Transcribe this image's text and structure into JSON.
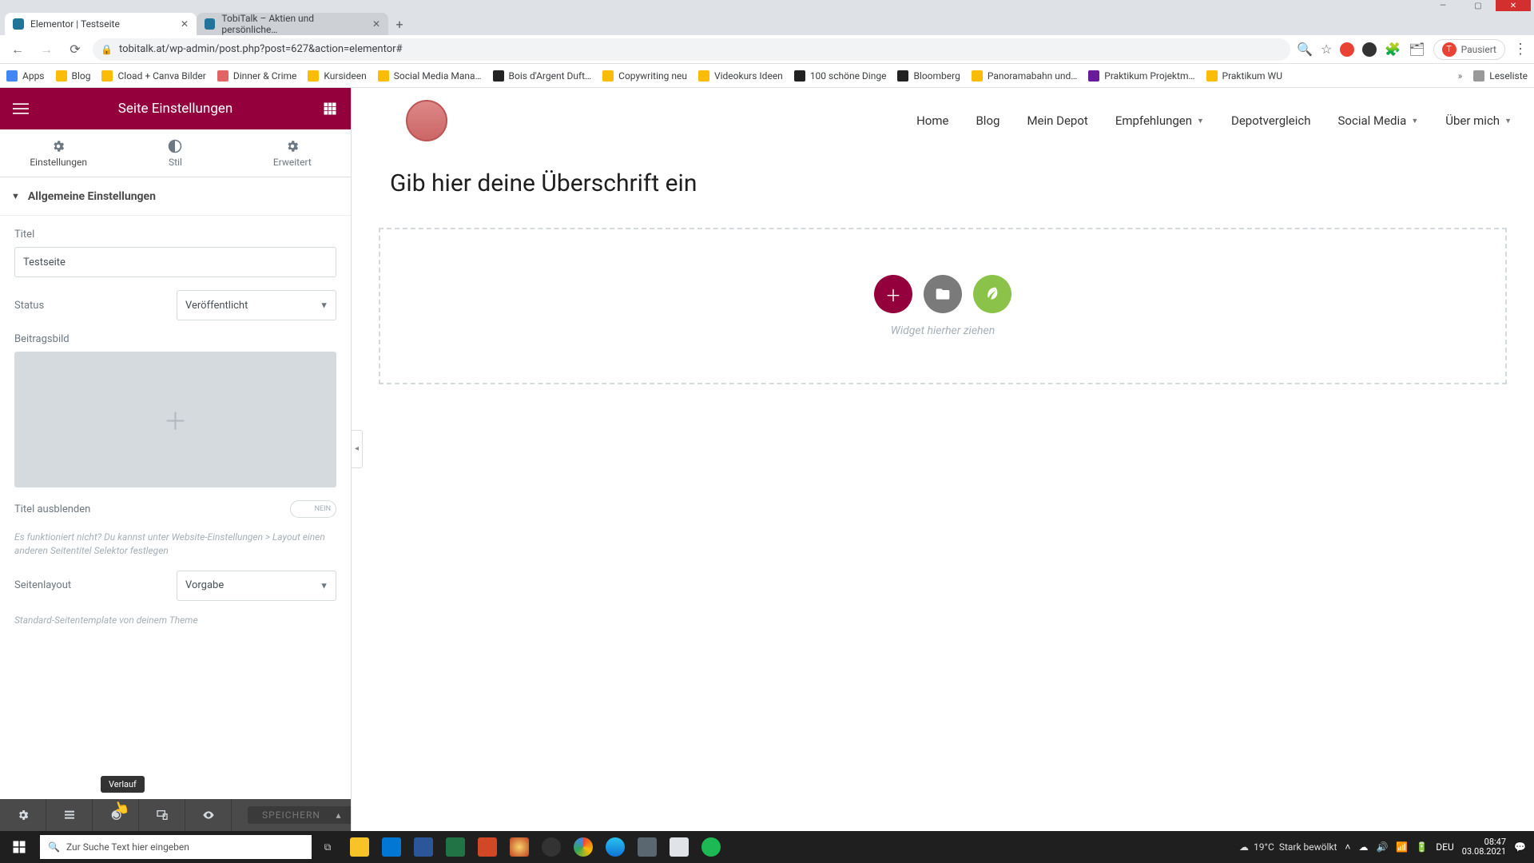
{
  "browser": {
    "tabs": [
      {
        "title": "Elementor | Testseite",
        "active": true
      },
      {
        "title": "TobiTalk – Aktien und persönliche…",
        "active": false
      }
    ],
    "url": "tobitalk.at/wp-admin/post.php?post=627&action=elementor#",
    "profile_label": "Pausiert",
    "profile_initial": "T",
    "bookmarks": [
      "Apps",
      "Blog",
      "Cload + Canva Bilder",
      "Dinner & Crime",
      "Kursideen",
      "Social Media Mana…",
      "Bois d'Argent Duft…",
      "Copywriting neu",
      "Videokurs Ideen",
      "100 schöne Dinge",
      "Bloomberg",
      "Panoramabahn und…",
      "Praktikum Projektm…",
      "Praktikum WU"
    ],
    "readlist_label": "Leseliste"
  },
  "sidebar": {
    "title": "Seite Einstellungen",
    "tabs": {
      "settings": "Einstellungen",
      "style": "Stil",
      "advanced": "Erweitert"
    },
    "accordion": "Allgemeine Einstellungen",
    "labels": {
      "title": "Titel",
      "status": "Status",
      "featured": "Beitragsbild",
      "hide_title": "Titel ausblenden",
      "hint1": "Es funktioniert nicht? Du kannst unter Website-Einstellungen > Layout einen anderen Seitentitel Selektor festlegen",
      "layout": "Seitenlayout",
      "hint2": "Standard-Seitentemplate von deinem Theme"
    },
    "values": {
      "title": "Testseite",
      "status": "Veröffentlicht",
      "layout": "Vorgabe",
      "hide_title_toggle": "NEIN"
    },
    "footer": {
      "tooltip": "Verlauf",
      "save": "SPEICHERN"
    }
  },
  "canvas": {
    "nav": [
      "Home",
      "Blog",
      "Mein Depot",
      "Empfehlungen",
      "Depotvergleich",
      "Social Media",
      "Über mich"
    ],
    "nav_dropdown": [
      false,
      false,
      false,
      true,
      false,
      true,
      true
    ],
    "heading": "Gib hier deine Überschrift ein",
    "drop_hint": "Widget hierher ziehen"
  },
  "taskbar": {
    "search_placeholder": "Zur Suche Text hier eingeben",
    "weather_temp": "19°C",
    "weather_text": "Stark bewölkt",
    "lang": "DEU",
    "time": "08:47",
    "date": "03.08.2021"
  }
}
